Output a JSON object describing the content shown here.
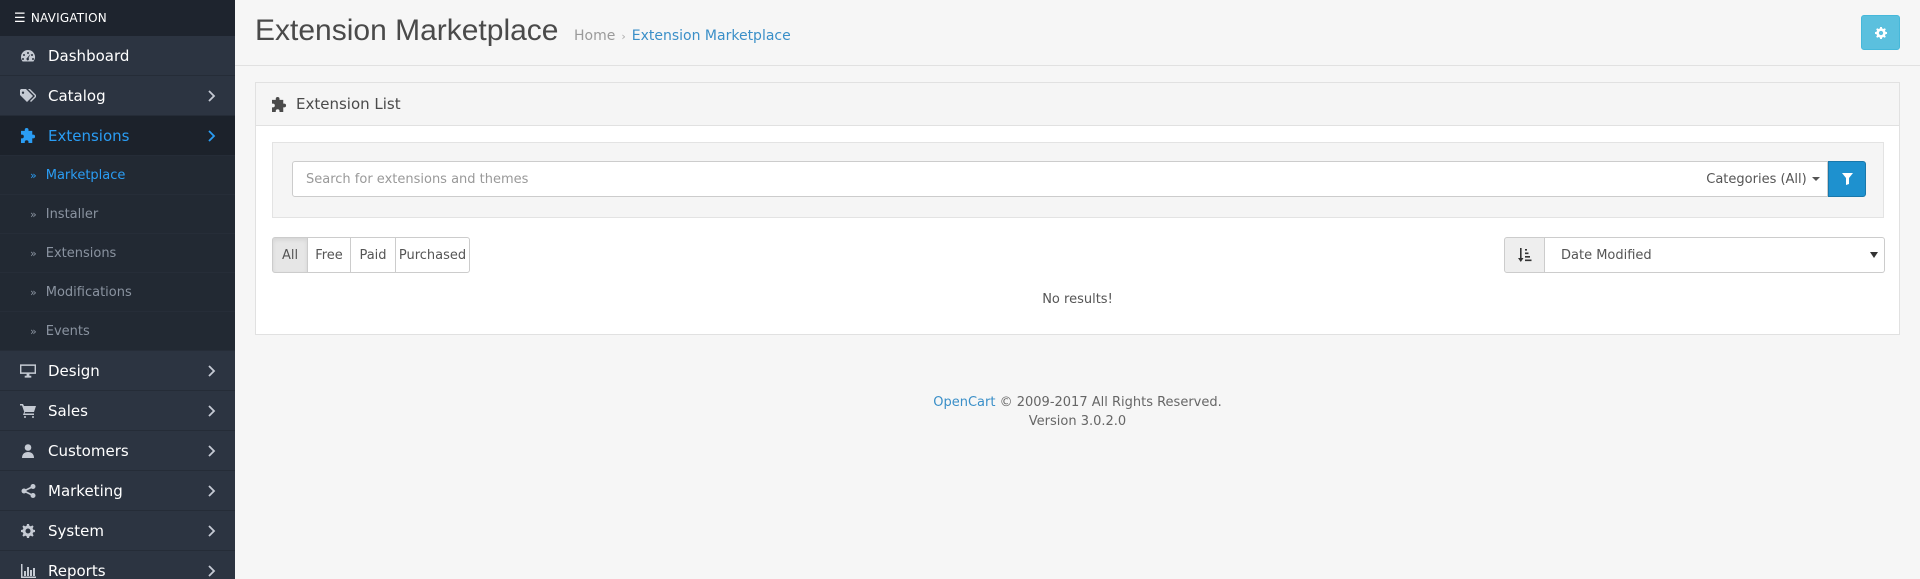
{
  "sidebar": {
    "header": "NAVIGATION",
    "items": [
      {
        "label": "Dashboard",
        "icon": "dashboard-icon",
        "chevron": false
      },
      {
        "label": "Catalog",
        "icon": "tags-icon",
        "chevron": true
      },
      {
        "label": "Extensions",
        "icon": "puzzle-icon",
        "chevron": true,
        "active": true
      },
      {
        "label": "Design",
        "icon": "monitor-icon",
        "chevron": true
      },
      {
        "label": "Sales",
        "icon": "cart-icon",
        "chevron": true
      },
      {
        "label": "Customers",
        "icon": "user-icon",
        "chevron": true
      },
      {
        "label": "Marketing",
        "icon": "share-icon",
        "chevron": true
      },
      {
        "label": "System",
        "icon": "gear-icon",
        "chevron": true
      },
      {
        "label": "Reports",
        "icon": "bar-chart-icon",
        "chevron": true
      }
    ],
    "sub_items": [
      {
        "label": "Marketplace",
        "active": true
      },
      {
        "label": "Installer"
      },
      {
        "label": "Extensions"
      },
      {
        "label": "Modifications"
      },
      {
        "label": "Events"
      }
    ]
  },
  "header": {
    "title": "Extension Marketplace",
    "breadcrumb": [
      "Home",
      "Extension Marketplace"
    ]
  },
  "panel": {
    "title": "Extension List",
    "search_placeholder": "Search for extensions and themes",
    "categories_label": "Categories (All)",
    "filters": [
      "All",
      "Free",
      "Paid",
      "Purchased"
    ],
    "sort_value": "Date Modified",
    "no_results": "No results!"
  },
  "footer": {
    "brand": "OpenCart",
    "copyright": " © 2009-2017 All Rights Reserved.",
    "version": "Version 3.0.2.0"
  },
  "colors": {
    "sidebar_bg": "#2c3441",
    "accent": "#2a9df4",
    "info_button": "#5bc0de",
    "primary_button": "#1e91cf"
  }
}
